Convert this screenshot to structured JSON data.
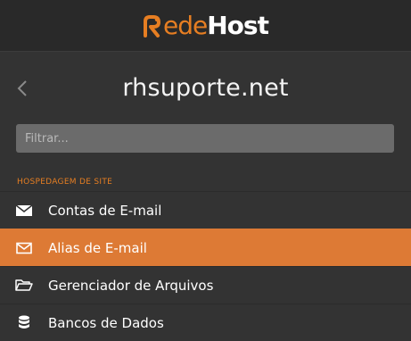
{
  "brand": {
    "logo_part1": "ede",
    "logo_part2": "Host",
    "logo_text": "RedeHost",
    "accent_color": "#e67e22"
  },
  "site": {
    "title": "rhsuporte.net",
    "back_icon": "chevron-left-icon"
  },
  "filter": {
    "placeholder": "Filtrar...",
    "value": ""
  },
  "menu": {
    "section_title": "HOSPEDAGEM DE SITE",
    "items": [
      {
        "label": "Contas de E-mail",
        "icon": "envelope-icon",
        "active": false
      },
      {
        "label": "Alias de E-mail",
        "icon": "envelope-outline-icon",
        "active": true
      },
      {
        "label": "Gerenciador de Arquivos",
        "icon": "folder-open-icon",
        "active": false
      },
      {
        "label": "Bancos de Dados",
        "icon": "database-icon",
        "active": false
      }
    ]
  },
  "colors": {
    "background": "#333333",
    "topbar": "#292929",
    "active_item": "#dd7a35",
    "input_bg": "#6b6b6b"
  }
}
